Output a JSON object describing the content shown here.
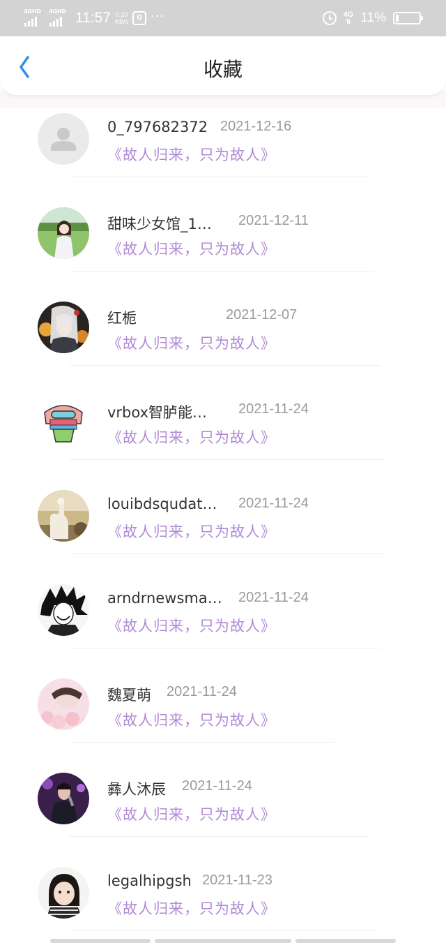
{
  "status_bar": {
    "sim1_label": "4GHD",
    "sim2_label": "4GHD",
    "time": "11:57",
    "speed_value": "0.20",
    "speed_unit": "KB/s",
    "app_icon": "Q",
    "dots": "···",
    "network": "4G",
    "battery_percent": "11%",
    "battery_level": 0.11,
    "icons": [
      "signal-icon",
      "signal-icon",
      "app-notification-icon",
      "alarm-icon",
      "network-4g-icon",
      "battery-icon"
    ]
  },
  "header": {
    "title": "收藏",
    "back_icon": "chevron-left-icon",
    "accent_color": "#2e8fe6"
  },
  "colors": {
    "title_link": "#b08ad6",
    "date": "#9a9a9a",
    "name": "#333333"
  },
  "favorites": [
    {
      "name": "0_797682372",
      "date": "2021-12-16",
      "title": "《故人归来，只为故人》",
      "avatar": "default-avatar-icon"
    },
    {
      "name": "甜味少女馆_1…",
      "date": "2021-12-11",
      "title": "《故人归来，只为故人》",
      "avatar": "girl-meadow-photo"
    },
    {
      "name": "红栀",
      "date": "2021-12-07",
      "title": "《故人归来，只为故人》",
      "avatar": "anime-girl-photo"
    },
    {
      "name": "vrbox智胪能…",
      "date": "2021-11-24",
      "title": "《故人归来，只为故人》",
      "avatar": "cartoon-goggles-photo"
    },
    {
      "name": "louibdsqudat…",
      "date": "2021-11-24",
      "title": "《故人归来，只为故人》",
      "avatar": "alpaca-photo"
    },
    {
      "name": "arndrnewsma…",
      "date": "2021-11-24",
      "title": "《故人归来，只为故人》",
      "avatar": "manga-sketch-photo"
    },
    {
      "name": "魏夏萌",
      "date": "2021-11-24",
      "title": "《故人归来，只为故人》",
      "avatar": "girl-flowers-photo"
    },
    {
      "name": "彝人沐辰",
      "date": "2021-11-24",
      "title": "《故人归来，只为故人》",
      "avatar": "stage-singer-photo"
    },
    {
      "name": "legalhipgsh",
      "date": "2021-11-23",
      "title": "《故人归来，只为故人》",
      "avatar": "child-portrait-photo"
    }
  ]
}
